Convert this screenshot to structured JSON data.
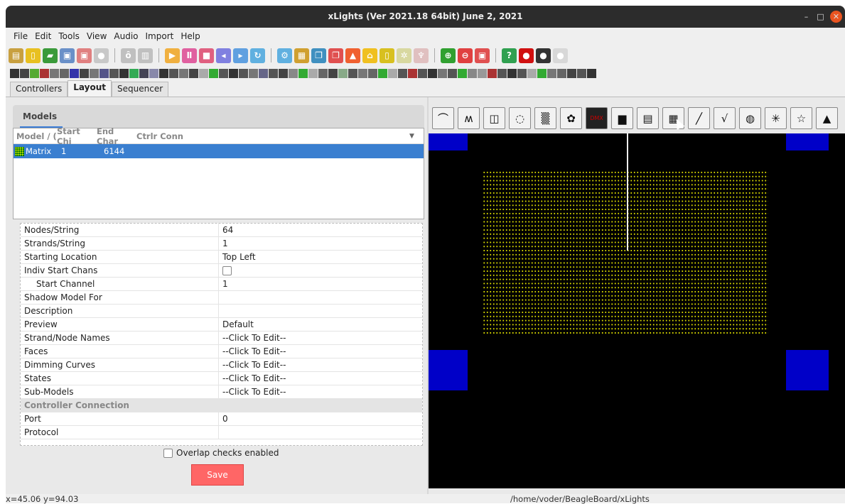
{
  "window": {
    "title": "xLights (Ver 2021.18 64bit) June 2, 2021",
    "minimize": "–",
    "maximize": "□",
    "close": "✕"
  },
  "menu": [
    "File",
    "Edit",
    "Tools",
    "View",
    "Audio",
    "Import",
    "Help"
  ],
  "toolbar_icons": [
    {
      "name": "open-folder-icon",
      "color": "#c8a040",
      "glyph": "▤"
    },
    {
      "name": "new-file-icon",
      "color": "#e8c020",
      "glyph": "▯"
    },
    {
      "name": "open-icon",
      "color": "#3a9a3a",
      "glyph": "▰"
    },
    {
      "name": "save-icon",
      "color": "#6a90c8",
      "glyph": "▣"
    },
    {
      "name": "save-as-icon",
      "color": "#e08080",
      "glyph": "▣"
    },
    {
      "name": "sequence-settings-icon",
      "color": "#c8c8c8",
      "glyph": "●"
    },
    {
      "name": "sep"
    },
    {
      "name": "render-icon",
      "color": "#c0c0c0",
      "glyph": "ȏ"
    },
    {
      "name": "export-icon",
      "color": "#c0c0c0",
      "glyph": "▥"
    },
    {
      "name": "sep"
    },
    {
      "name": "play-icon",
      "color": "#f0b040",
      "glyph": "▶"
    },
    {
      "name": "pause-icon",
      "color": "#e060a0",
      "glyph": "Ⅱ"
    },
    {
      "name": "stop-icon",
      "color": "#e06080",
      "glyph": "■"
    },
    {
      "name": "rewind-icon",
      "color": "#8080e0",
      "glyph": "◂"
    },
    {
      "name": "fast-forward-icon",
      "color": "#60a0e0",
      "glyph": "▸"
    },
    {
      "name": "replay-icon",
      "color": "#60b0e0",
      "glyph": "↻"
    },
    {
      "name": "sep"
    },
    {
      "name": "gear-icon",
      "color": "#60b0e0",
      "glyph": "⚙"
    },
    {
      "name": "grid-icon",
      "color": "#d0a030",
      "glyph": "▦"
    },
    {
      "name": "copy-icon",
      "color": "#4090c0",
      "glyph": "❐"
    },
    {
      "name": "paste-icon",
      "color": "#e05050",
      "glyph": "❐"
    },
    {
      "name": "triangle-icon",
      "color": "#f06030",
      "glyph": "▲"
    },
    {
      "name": "house-icon",
      "color": "#f0c020",
      "glyph": "⌂"
    },
    {
      "name": "lamp-icon",
      "color": "#d8c020",
      "glyph": "▯"
    },
    {
      "name": "settings-icon",
      "color": "#d8d8a0",
      "glyph": "✲"
    },
    {
      "name": "brush-icon",
      "color": "#e0c0c0",
      "glyph": "♆"
    },
    {
      "name": "sep"
    },
    {
      "name": "zoom-in-icon",
      "color": "#30a030",
      "glyph": "⊕"
    },
    {
      "name": "zoom-out-icon",
      "color": "#e04040",
      "glyph": "⊖"
    },
    {
      "name": "fit-icon",
      "color": "#e05050",
      "glyph": "▣"
    },
    {
      "name": "sep"
    },
    {
      "name": "help-icon",
      "color": "#30a050",
      "glyph": "?"
    },
    {
      "name": "stop-sign-icon",
      "color": "#d01010",
      "glyph": "●"
    },
    {
      "name": "bulb-dark-icon",
      "color": "#333333",
      "glyph": "●"
    },
    {
      "name": "bulb-light-icon",
      "color": "#d8d8d8",
      "glyph": "●"
    }
  ],
  "effect_colors": [
    "#333",
    "#444",
    "#5a3",
    "#a33",
    "#777",
    "#666",
    "#33a",
    "#444",
    "#777",
    "#558",
    "#555",
    "#333",
    "#3a5",
    "#445",
    "#88a",
    "#333",
    "#555",
    "#777",
    "#444",
    "#aaa",
    "#3a3",
    "#555",
    "#333",
    "#555",
    "#777",
    "#668",
    "#555",
    "#444",
    "#888",
    "#3a3",
    "#aaa",
    "#666",
    "#444",
    "#8a8",
    "#555",
    "#777",
    "#666",
    "#3a3",
    "#aaa",
    "#555",
    "#a33",
    "#555",
    "#333",
    "#777",
    "#555",
    "#3a3",
    "#888",
    "#999",
    "#a33",
    "#555",
    "#333",
    "#555",
    "#aaa",
    "#3a3",
    "#777",
    "#666",
    "#444",
    "#555",
    "#333"
  ],
  "tabs": [
    {
      "label": "Controllers",
      "active": false
    },
    {
      "label": "Layout",
      "active": true
    },
    {
      "label": "Sequencer",
      "active": false
    }
  ],
  "models_panel": {
    "tab_label": "Models",
    "columns": [
      "Model / (",
      "Start Chi",
      "End Char",
      "Ctrlr Conn"
    ],
    "rows": [
      {
        "model": "Matrix",
        "start": "1",
        "end": "6144",
        "conn": ""
      }
    ]
  },
  "properties": [
    {
      "key": "Nodes/String",
      "value": "64"
    },
    {
      "key": "Strands/String",
      "value": "1"
    },
    {
      "key": "Starting Location",
      "value": "Top Left"
    },
    {
      "key": "Indiv Start Chans",
      "value": "",
      "checkbox": true,
      "expander": "▼"
    },
    {
      "key": "Start Channel",
      "value": "1",
      "indent": true
    },
    {
      "key": "Shadow Model For",
      "value": ""
    },
    {
      "key": "Description",
      "value": ""
    },
    {
      "key": "Preview",
      "value": "Default"
    },
    {
      "key": "Strand/Node Names",
      "value": "--Click To Edit--"
    },
    {
      "key": "Faces",
      "value": "--Click To Edit--"
    },
    {
      "key": "Dimming Curves",
      "value": "--Click To Edit--"
    },
    {
      "key": "States",
      "value": "--Click To Edit--"
    },
    {
      "key": "Sub-Models",
      "value": "--Click To Edit--"
    },
    {
      "key": "Controller Connection",
      "value": "",
      "category": true,
      "expander": "▼"
    },
    {
      "key": "Port",
      "value": "0"
    },
    {
      "key": "Protocol",
      "value": ""
    }
  ],
  "overlap_label": "Overlap checks enabled",
  "save_label": "Save",
  "shape_buttons": [
    {
      "name": "arch-icon",
      "glyph": "⌒"
    },
    {
      "name": "candy-cane-icon",
      "glyph": "ʍ"
    },
    {
      "name": "window-frame-icon",
      "glyph": "◫"
    },
    {
      "name": "circle-icon",
      "glyph": "◌"
    },
    {
      "name": "dense-grid-icon",
      "glyph": "▒"
    },
    {
      "name": "wreath-icon",
      "glyph": "✿"
    },
    {
      "name": "dmx-icon",
      "glyph": "DMX"
    },
    {
      "name": "image-icon",
      "glyph": "▆"
    },
    {
      "name": "icicles-icon",
      "glyph": "▤"
    },
    {
      "name": "matrix-icon",
      "glyph": "▦"
    },
    {
      "name": "single-line-icon",
      "glyph": "╱"
    },
    {
      "name": "poly-line-icon",
      "glyph": "√"
    },
    {
      "name": "sphere-icon",
      "glyph": "◍"
    },
    {
      "name": "star-burst-icon",
      "glyph": "✳"
    },
    {
      "name": "star-icon",
      "glyph": "☆"
    },
    {
      "name": "tree-icon",
      "glyph": "▲"
    }
  ],
  "status": {
    "coords": "x=45.06 y=94.03",
    "path": "/home/voder/BeagleBoard/xLights"
  }
}
